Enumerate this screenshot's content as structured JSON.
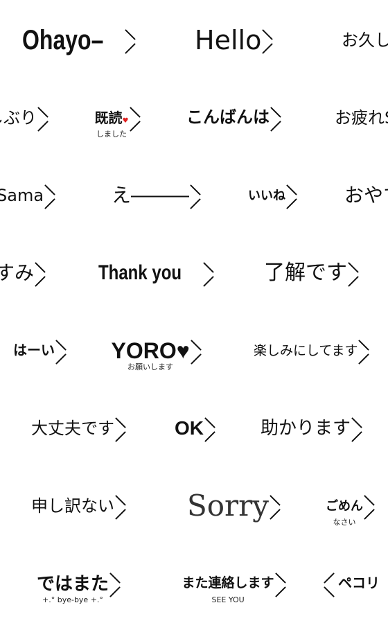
{
  "grid": {
    "columns": 5,
    "rows": 8
  },
  "stickers": [
    {
      "id": "ohayo",
      "tiles": 2,
      "start": 0,
      "text": "Ohayo–",
      "sub": "",
      "style": "s-cond",
      "size": 40,
      "bracket": "right"
    },
    {
      "id": "hello",
      "tiles": 2,
      "start": 2,
      "text": "Hello",
      "sub": "",
      "style": "s-thin",
      "size": 38,
      "bracket": "right"
    },
    {
      "id": "ohisashiburi",
      "tiles": 2,
      "start": 4,
      "text": "お久しぶり",
      "sub": "",
      "style": "s-thin",
      "size": 24,
      "bracket": "right"
    },
    {
      "id": "kidoku",
      "tiles": 1,
      "start": 6,
      "text": "既読",
      "sub": "しました",
      "heart": "♥",
      "style": "s-bold",
      "size": 20,
      "bracket": "right"
    },
    {
      "id": "konbanwa",
      "tiles": 2,
      "start": 7,
      "text": "こんばんは",
      "sub": "",
      "style": "s-heavy",
      "size": 24,
      "bracket": "right"
    },
    {
      "id": "otsukaresama",
      "tiles": 2,
      "start": 9,
      "text": "お疲れSama",
      "sub": "",
      "style": "s-thin",
      "size": 24,
      "bracket": "right"
    },
    {
      "id": "eee",
      "tiles": 2,
      "start": 11,
      "text": "え―――",
      "sub": "",
      "style": "s-thin",
      "size": 28,
      "bracket": "right"
    },
    {
      "id": "iine",
      "tiles": 1,
      "start": 13,
      "text": "いいね",
      "sub": "",
      "style": "s-heavy",
      "size": 18,
      "bracket": "right"
    },
    {
      "id": "oyasumi",
      "tiles": 2,
      "start": 14,
      "text": "おやすみ",
      "sub": "",
      "style": "s-thin",
      "size": 28,
      "bracket": "right"
    },
    {
      "id": "thankyou",
      "tiles": 2,
      "start": 16,
      "text": "Thank you",
      "sub": "",
      "style": "s-cond",
      "size": 30,
      "bracket": "right"
    },
    {
      "id": "ryoukai",
      "tiles": 2,
      "start": 18,
      "text": "了解です",
      "sub": "",
      "style": "s-thin",
      "size": 30,
      "bracket": "right"
    },
    {
      "id": "haai",
      "tiles": 1,
      "start": 20,
      "text": "はーい",
      "sub": "",
      "style": "s-heavy",
      "size": 20,
      "bracket": "right"
    },
    {
      "id": "yoroshiku",
      "tiles": 2,
      "start": 21,
      "text": "YORO♥",
      "sub": "お願いします",
      "style": "s-heavy",
      "size": 32,
      "bracket": "right"
    },
    {
      "id": "tanoshimi",
      "tiles": 2,
      "start": 23,
      "text": "楽しみにしてます",
      "sub": "",
      "style": "s-thin",
      "size": 19,
      "bracket": "right"
    },
    {
      "id": "daijoubu",
      "tiles": 2,
      "start": 25,
      "text": "大丈夫です",
      "sub": "",
      "style": "s-thin",
      "size": 24,
      "bracket": "right"
    },
    {
      "id": "ok",
      "tiles": 1,
      "start": 27,
      "text": "OK",
      "sub": "",
      "style": "s-heavy",
      "size": 28,
      "bracket": "right"
    },
    {
      "id": "tasukarimasu",
      "tiles": 2,
      "start": 28,
      "text": "助かります",
      "sub": "",
      "style": "s-thin",
      "size": 26,
      "bracket": "right"
    },
    {
      "id": "moushiwake",
      "tiles": 2,
      "start": 30,
      "text": "申し訳ない",
      "sub": "",
      "style": "s-thin",
      "size": 24,
      "bracket": "right"
    },
    {
      "id": "sorry",
      "tiles": 2,
      "start": 32,
      "text": "Sorry",
      "sub": "",
      "style": "s-hand",
      "size": 42,
      "bracket": "right"
    },
    {
      "id": "gomen",
      "tiles": 1,
      "start": 34,
      "text": "ごめん",
      "sub": "なさい",
      "style": "s-heavy",
      "size": 18,
      "bracket": "right"
    },
    {
      "id": "dewamata",
      "tiles": 2,
      "start": 35,
      "text": "ではまた",
      "sub": "+.° bye-bye +.°",
      "style": "s-heavy",
      "size": 26,
      "bracket": "right"
    },
    {
      "id": "matarenraku",
      "tiles": 2,
      "start": 37,
      "text": "また連絡します",
      "sub": "SEE YOU",
      "style": "s-heavy",
      "size": 19,
      "bracket": "right"
    },
    {
      "id": "pekori",
      "tiles": 1,
      "start": 39,
      "text": "ペコリ",
      "sub": "",
      "style": "s-heavy",
      "size": 20,
      "bracket": "left"
    }
  ]
}
